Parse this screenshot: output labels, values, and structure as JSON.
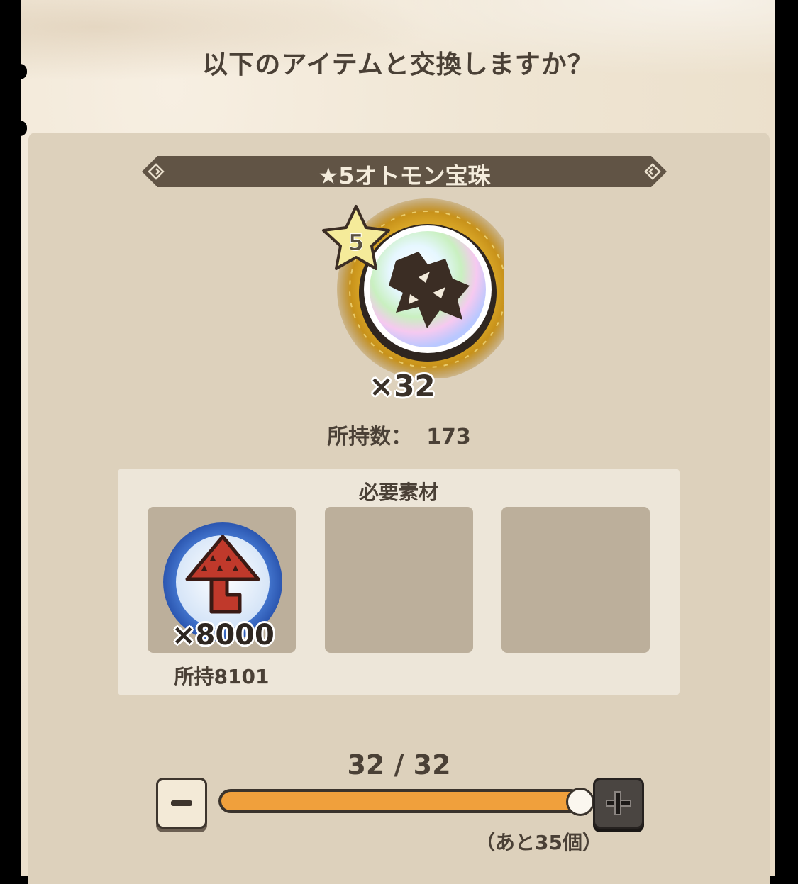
{
  "dialog": {
    "question": "以下のアイテムと交換しますか？"
  },
  "item": {
    "name": "★5オトモン宝珠",
    "rarity": "5",
    "quantity": "×32",
    "owned_label": "所持数：",
    "owned_value": "173",
    "icon": "monster-orb-icon"
  },
  "materials": {
    "title": "必要素材",
    "slots": [
      {
        "icon": "material-icon",
        "quantity": "×8000",
        "owned": "所持8101"
      },
      {
        "icon": "",
        "quantity": "",
        "owned": ""
      },
      {
        "icon": "",
        "quantity": "",
        "owned": ""
      }
    ]
  },
  "exchange": {
    "counter": "32 / 32",
    "value": 32,
    "max": 32,
    "remaining": "（あと35個）"
  },
  "colors": {
    "slider_fill": "#f0a03c",
    "banner": "#615445",
    "panel": "#ddd1bc"
  }
}
